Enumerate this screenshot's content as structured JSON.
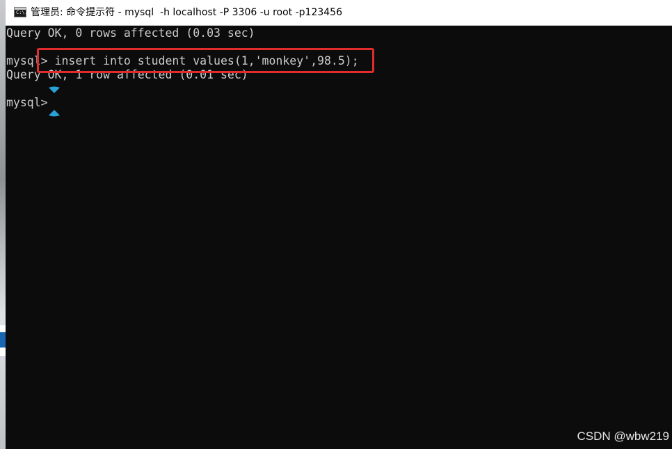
{
  "window": {
    "title": "管理员: 命令提示符 - mysql  -h localhost -P 3306 -u root -p123456",
    "icon_label": "C:\\."
  },
  "console": {
    "lines": [
      "Query OK, 0 rows affected (0.03 sec)",
      "",
      "mysql> insert into student values(1,'monkey',98.5);",
      "Query OK, 1 row affected (0.01 sec)",
      "",
      "mysql>"
    ]
  },
  "annotation": {
    "highlight_color": "#e02c2c",
    "marker_color": "#2aa0d8"
  },
  "watermark": "CSDN @wbw219"
}
